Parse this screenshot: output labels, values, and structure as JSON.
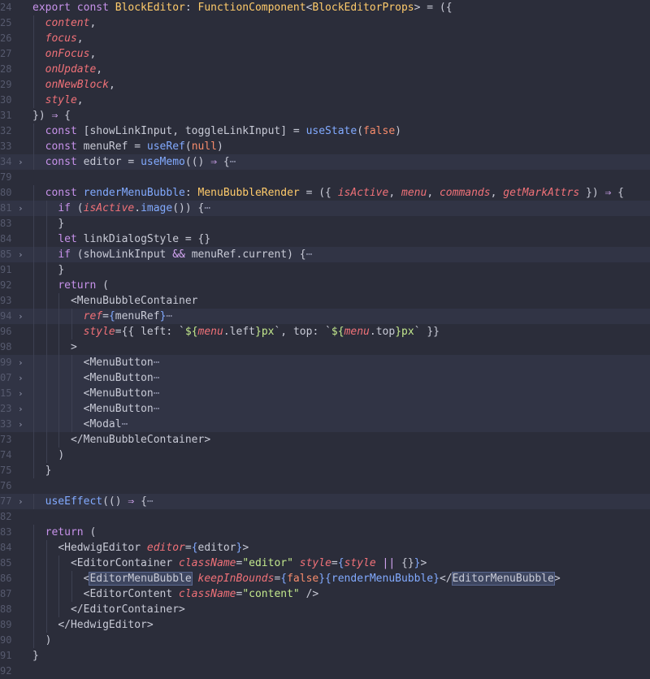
{
  "editor": {
    "lines": [
      {
        "n": "24",
        "fold": false,
        "folded": false,
        "indent": 0,
        "tokens": [
          [
            "kw",
            "export const "
          ],
          [
            "ty",
            "BlockEditor"
          ],
          [
            "pl",
            ": "
          ],
          [
            "ty",
            "FunctionComponent"
          ],
          [
            "pn",
            "<"
          ],
          [
            "ty",
            "BlockEditorProps"
          ],
          [
            "pn",
            "> = ({"
          ]
        ]
      },
      {
        "n": "25",
        "fold": false,
        "folded": false,
        "indent": 1,
        "tokens": [
          [
            "pm",
            "content"
          ],
          [
            "pn",
            ","
          ]
        ]
      },
      {
        "n": "26",
        "fold": false,
        "folded": false,
        "indent": 1,
        "tokens": [
          [
            "pm",
            "focus"
          ],
          [
            "pn",
            ","
          ]
        ]
      },
      {
        "n": "27",
        "fold": false,
        "folded": false,
        "indent": 1,
        "tokens": [
          [
            "pm",
            "onFocus"
          ],
          [
            "pn",
            ","
          ]
        ]
      },
      {
        "n": "28",
        "fold": false,
        "folded": false,
        "indent": 1,
        "tokens": [
          [
            "pm",
            "onUpdate"
          ],
          [
            "pn",
            ","
          ]
        ]
      },
      {
        "n": "29",
        "fold": false,
        "folded": false,
        "indent": 1,
        "tokens": [
          [
            "pm",
            "onNewBlock"
          ],
          [
            "pn",
            ","
          ]
        ]
      },
      {
        "n": "30",
        "fold": false,
        "folded": false,
        "indent": 1,
        "tokens": [
          [
            "pm",
            "style"
          ],
          [
            "pn",
            ","
          ]
        ]
      },
      {
        "n": "31",
        "fold": false,
        "folded": false,
        "indent": 0,
        "tokens": [
          [
            "pn",
            "}) "
          ],
          [
            "op",
            "⇒"
          ],
          [
            "pn",
            " {"
          ]
        ]
      },
      {
        "n": "32",
        "fold": false,
        "folded": false,
        "indent": 1,
        "tokens": [
          [
            "kw",
            "const "
          ],
          [
            "pn",
            "["
          ],
          [
            "pl",
            "showLinkInput"
          ],
          [
            "pn",
            ", "
          ],
          [
            "pl",
            "toggleLinkInput"
          ],
          [
            "pn",
            "] = "
          ],
          [
            "fn",
            "useState"
          ],
          [
            "pn",
            "("
          ],
          [
            "lit",
            "false"
          ],
          [
            "pn",
            ")"
          ]
        ]
      },
      {
        "n": "33",
        "fold": false,
        "folded": false,
        "indent": 1,
        "tokens": [
          [
            "kw",
            "const "
          ],
          [
            "pl",
            "menuRef"
          ],
          [
            "pn",
            " = "
          ],
          [
            "fn",
            "useRef"
          ],
          [
            "pn",
            "("
          ],
          [
            "lit",
            "null"
          ],
          [
            "pn",
            ")"
          ]
        ]
      },
      {
        "n": "34",
        "fold": true,
        "folded": true,
        "indent": 1,
        "tokens": [
          [
            "kw",
            "const "
          ],
          [
            "pl",
            "editor"
          ],
          [
            "pn",
            " = "
          ],
          [
            "fn",
            "useMemo"
          ],
          [
            "pn",
            "(() "
          ],
          [
            "op",
            "⇒"
          ],
          [
            "pn",
            " {"
          ],
          [
            "ell",
            "⋯"
          ]
        ]
      },
      {
        "n": "79",
        "fold": false,
        "folded": false,
        "indent": 0,
        "tokens": []
      },
      {
        "n": "80",
        "fold": false,
        "folded": false,
        "indent": 1,
        "tokens": [
          [
            "kw",
            "const "
          ],
          [
            "fn",
            "renderMenuBubble"
          ],
          [
            "pl",
            ": "
          ],
          [
            "ty",
            "MenuBubbleRender"
          ],
          [
            "pn",
            " = ({ "
          ],
          [
            "it",
            "isActive"
          ],
          [
            "pn",
            ", "
          ],
          [
            "it",
            "menu"
          ],
          [
            "pn",
            ", "
          ],
          [
            "it",
            "commands"
          ],
          [
            "pn",
            ", "
          ],
          [
            "it",
            "getMarkAttrs"
          ],
          [
            "pn",
            " }) "
          ],
          [
            "op",
            "⇒"
          ],
          [
            "pn",
            " {"
          ]
        ]
      },
      {
        "n": "81",
        "fold": true,
        "folded": true,
        "indent": 2,
        "tokens": [
          [
            "kw",
            "if "
          ],
          [
            "pn",
            "("
          ],
          [
            "it",
            "isActive"
          ],
          [
            "pn",
            "."
          ],
          [
            "fn",
            "image"
          ],
          [
            "pn",
            "()) {"
          ],
          [
            "ell",
            "⋯"
          ]
        ]
      },
      {
        "n": "83",
        "fold": false,
        "folded": false,
        "indent": 2,
        "tokens": [
          [
            "pn",
            "}"
          ]
        ]
      },
      {
        "n": "84",
        "fold": false,
        "folded": false,
        "indent": 2,
        "tokens": [
          [
            "kw",
            "let "
          ],
          [
            "pl",
            "linkDialogStyle"
          ],
          [
            "pn",
            " = {}"
          ]
        ]
      },
      {
        "n": "85",
        "fold": true,
        "folded": true,
        "indent": 2,
        "tokens": [
          [
            "kw",
            "if "
          ],
          [
            "pn",
            "("
          ],
          [
            "pl",
            "showLinkInput"
          ],
          [
            "op",
            " && "
          ],
          [
            "pl",
            "menuRef"
          ],
          [
            "pn",
            "."
          ],
          [
            "pl",
            "current"
          ],
          [
            "pn",
            ") {"
          ],
          [
            "ell",
            "⋯"
          ]
        ]
      },
      {
        "n": "91",
        "fold": false,
        "folded": false,
        "indent": 2,
        "tokens": [
          [
            "pn",
            "}"
          ]
        ]
      },
      {
        "n": "92",
        "fold": false,
        "folded": false,
        "indent": 2,
        "tokens": [
          [
            "kw",
            "return "
          ],
          [
            "pn",
            "("
          ]
        ]
      },
      {
        "n": "93",
        "fold": false,
        "folded": false,
        "indent": 3,
        "tokens": [
          [
            "tg",
            "<MenuBubbleContainer"
          ]
        ]
      },
      {
        "n": "94",
        "fold": true,
        "folded": true,
        "indent": 4,
        "tokens": [
          [
            "at",
            "ref"
          ],
          [
            "pn",
            "="
          ],
          [
            "pr",
            "{"
          ],
          [
            "pl",
            "menuRef"
          ],
          [
            "pr",
            "}"
          ],
          [
            "ell",
            "⋯"
          ]
        ]
      },
      {
        "n": "96",
        "fold": false,
        "folded": false,
        "indent": 4,
        "tokens": [
          [
            "at",
            "style"
          ],
          [
            "pn",
            "={{ "
          ],
          [
            "pl",
            "left"
          ],
          [
            "pn",
            ": `"
          ],
          [
            "str",
            "${"
          ],
          [
            "it",
            "menu"
          ],
          [
            "pn",
            "."
          ],
          [
            "pl",
            "left"
          ],
          [
            "str",
            "}"
          ],
          [
            "str",
            "px"
          ],
          [
            "pn",
            "`, "
          ],
          [
            "pl",
            "top"
          ],
          [
            "pn",
            ": `"
          ],
          [
            "str",
            "${"
          ],
          [
            "it",
            "menu"
          ],
          [
            "pn",
            "."
          ],
          [
            "pl",
            "top"
          ],
          [
            "str",
            "}"
          ],
          [
            "str",
            "px"
          ],
          [
            "pn",
            "` }}"
          ]
        ]
      },
      {
        "n": "98",
        "fold": false,
        "folded": false,
        "indent": 3,
        "tokens": [
          [
            "tg",
            ">"
          ]
        ]
      },
      {
        "n": "99",
        "fold": true,
        "folded": true,
        "indent": 4,
        "tokens": [
          [
            "tg",
            "<MenuButton"
          ],
          [
            "ell",
            "⋯"
          ]
        ]
      },
      {
        "n": "07",
        "fold": true,
        "folded": true,
        "indent": 4,
        "tokens": [
          [
            "tg",
            "<MenuButton"
          ],
          [
            "ell",
            "⋯"
          ]
        ]
      },
      {
        "n": "15",
        "fold": true,
        "folded": true,
        "indent": 4,
        "tokens": [
          [
            "tg",
            "<MenuButton"
          ],
          [
            "ell",
            "⋯"
          ]
        ]
      },
      {
        "n": "23",
        "fold": true,
        "folded": true,
        "indent": 4,
        "tokens": [
          [
            "tg",
            "<MenuButton"
          ],
          [
            "ell",
            "⋯"
          ]
        ]
      },
      {
        "n": "33",
        "fold": true,
        "folded": true,
        "indent": 4,
        "tokens": [
          [
            "tg",
            "<Modal"
          ],
          [
            "ell",
            "⋯"
          ]
        ]
      },
      {
        "n": "73",
        "fold": false,
        "folded": false,
        "indent": 3,
        "tokens": [
          [
            "tg",
            "</MenuBubbleContainer>"
          ]
        ]
      },
      {
        "n": "74",
        "fold": false,
        "folded": false,
        "indent": 2,
        "tokens": [
          [
            "pn",
            ")"
          ]
        ]
      },
      {
        "n": "75",
        "fold": false,
        "folded": false,
        "indent": 1,
        "tokens": [
          [
            "pn",
            "}"
          ]
        ]
      },
      {
        "n": "76",
        "fold": false,
        "folded": false,
        "indent": 0,
        "tokens": []
      },
      {
        "n": "77",
        "fold": true,
        "folded": true,
        "indent": 1,
        "tokens": [
          [
            "fn",
            "useEffect"
          ],
          [
            "pn",
            "(() "
          ],
          [
            "op",
            "⇒"
          ],
          [
            "pn",
            " {"
          ],
          [
            "ell",
            "⋯"
          ]
        ]
      },
      {
        "n": "82",
        "fold": false,
        "folded": false,
        "indent": 0,
        "tokens": []
      },
      {
        "n": "83",
        "fold": false,
        "folded": false,
        "indent": 1,
        "tokens": [
          [
            "kw",
            "return "
          ],
          [
            "pn",
            "("
          ]
        ]
      },
      {
        "n": "84",
        "fold": false,
        "folded": false,
        "indent": 2,
        "tokens": [
          [
            "tg",
            "<HedwigEditor "
          ],
          [
            "at",
            "editor"
          ],
          [
            "pn",
            "="
          ],
          [
            "pr",
            "{"
          ],
          [
            "pl",
            "editor"
          ],
          [
            "pr",
            "}"
          ],
          [
            "tg",
            ">"
          ]
        ]
      },
      {
        "n": "85",
        "fold": false,
        "folded": false,
        "indent": 3,
        "tokens": [
          [
            "tg",
            "<EditorContainer "
          ],
          [
            "at",
            "className"
          ],
          [
            "pn",
            "="
          ],
          [
            "str",
            "\"editor\""
          ],
          [
            "pl",
            " "
          ],
          [
            "at",
            "style"
          ],
          [
            "pn",
            "="
          ],
          [
            "pr",
            "{"
          ],
          [
            "it",
            "style"
          ],
          [
            "op",
            " || "
          ],
          [
            "pn",
            "{}"
          ],
          [
            "pr",
            "}"
          ],
          [
            "tg",
            ">"
          ]
        ]
      },
      {
        "n": "86",
        "fold": false,
        "folded": false,
        "indent": 4,
        "tokens": [
          [
            "tg",
            "<"
          ],
          [
            "hl",
            "EditorMenuBubble"
          ],
          [
            "pl",
            " "
          ],
          [
            "at",
            "keepInBounds"
          ],
          [
            "pn",
            "="
          ],
          [
            "pr",
            "{"
          ],
          [
            "lit",
            "false"
          ],
          [
            "pr",
            "}{"
          ],
          [
            "fn",
            "renderMenuBubble"
          ],
          [
            "pr",
            "}"
          ],
          [
            "tg",
            "</"
          ],
          [
            "hl",
            "EditorMenuBubble"
          ],
          [
            "tg",
            ">"
          ]
        ]
      },
      {
        "n": "87",
        "fold": false,
        "folded": false,
        "indent": 4,
        "tokens": [
          [
            "tg",
            "<EditorContent "
          ],
          [
            "at",
            "className"
          ],
          [
            "pn",
            "="
          ],
          [
            "str",
            "\"content\""
          ],
          [
            "tg",
            " />"
          ]
        ]
      },
      {
        "n": "88",
        "fold": false,
        "folded": false,
        "indent": 3,
        "tokens": [
          [
            "tg",
            "</EditorContainer>"
          ]
        ]
      },
      {
        "n": "89",
        "fold": false,
        "folded": false,
        "indent": 2,
        "tokens": [
          [
            "tg",
            "</HedwigEditor>"
          ]
        ]
      },
      {
        "n": "90",
        "fold": false,
        "folded": false,
        "indent": 1,
        "tokens": [
          [
            "pn",
            ")"
          ]
        ]
      },
      {
        "n": "91",
        "fold": false,
        "folded": false,
        "indent": 0,
        "tokens": [
          [
            "pn",
            "}"
          ]
        ]
      },
      {
        "n": "92",
        "fold": false,
        "folded": false,
        "indent": 0,
        "tokens": []
      }
    ]
  }
}
